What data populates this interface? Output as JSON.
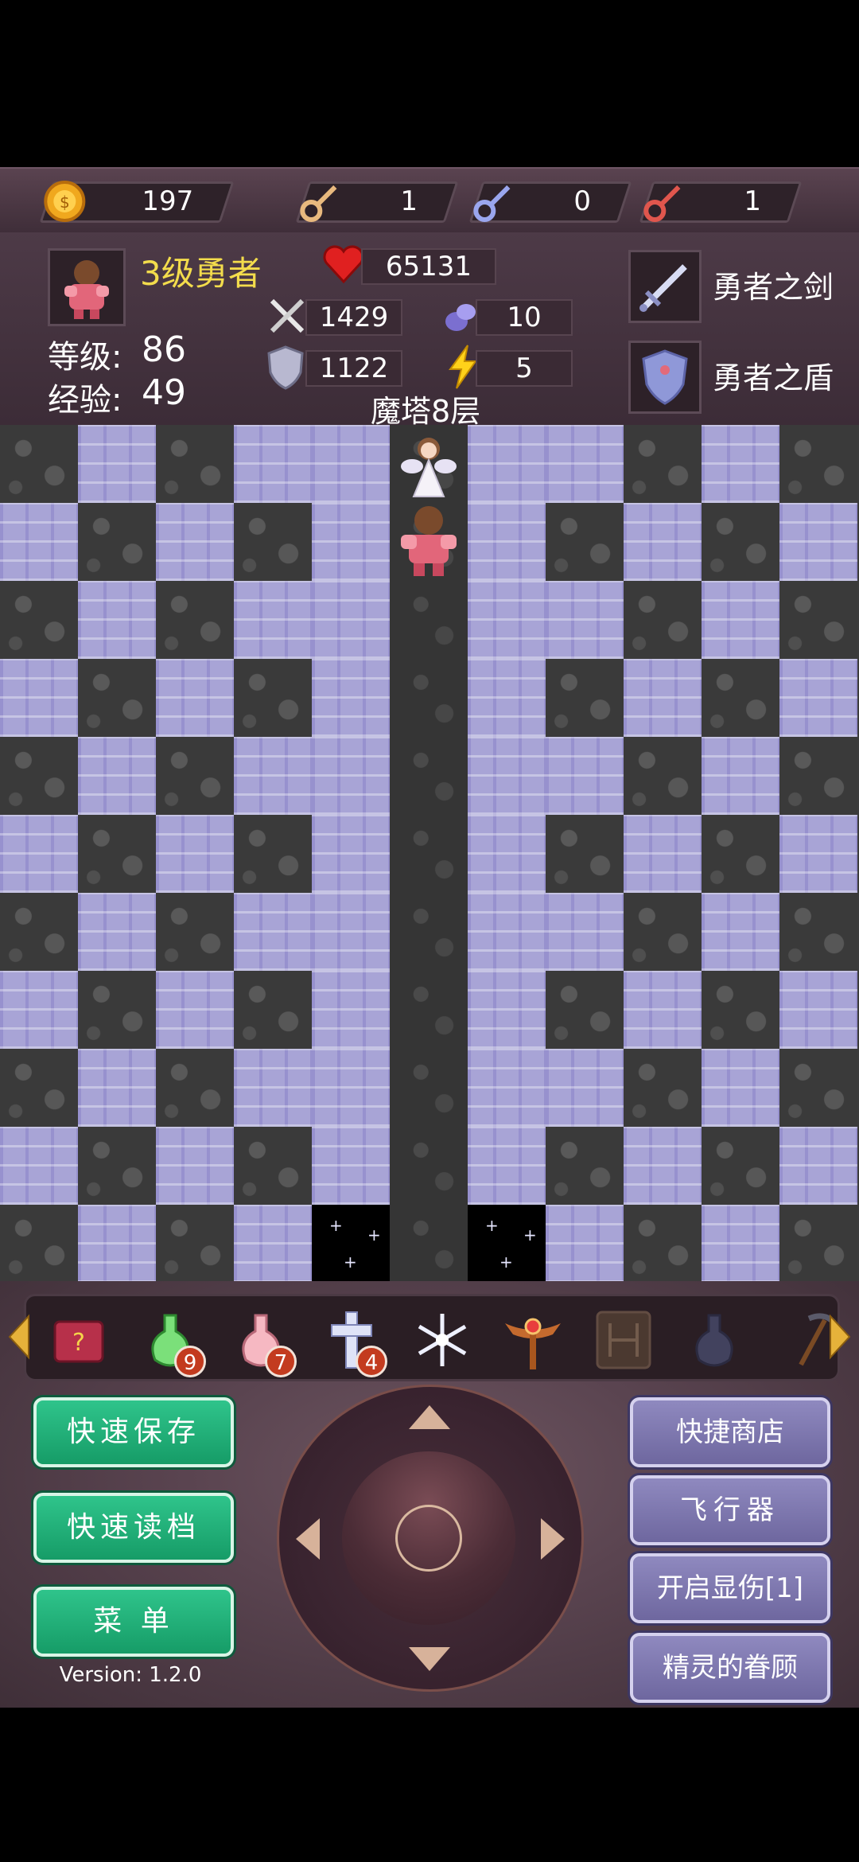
{
  "resources": {
    "gold": "197",
    "yellow_key": "1",
    "blue_key": "0",
    "red_key": "1"
  },
  "hero": {
    "title": "3级勇者",
    "level_label": "等级:",
    "level": "86",
    "exp_label": "经验:",
    "exp": "49",
    "hp": "65131",
    "atk": "1429",
    "def": "1122",
    "mdef": "10",
    "speed": "5",
    "floor": "魔塔8层"
  },
  "equipment": {
    "weapon": "勇者之剑",
    "shield": "勇者之盾"
  },
  "items": [
    {
      "icon": "book-icon",
      "count": ""
    },
    {
      "icon": "green-potion-icon",
      "count": "9"
    },
    {
      "icon": "pink-potion-icon",
      "count": "7"
    },
    {
      "icon": "cross-icon",
      "count": "4"
    },
    {
      "icon": "snowflake-icon",
      "count": ""
    },
    {
      "icon": "winged-staff-icon",
      "count": ""
    },
    {
      "icon": "rune-tablet-icon",
      "count": ""
    },
    {
      "icon": "dark-flask-icon",
      "count": ""
    },
    {
      "icon": "pickaxe-icon",
      "count": ""
    }
  ],
  "buttons": {
    "quick_save": "快速保存",
    "quick_load": "快速读档",
    "menu": "菜  单",
    "shop": "快捷商店",
    "fly": "飞行器",
    "damage": "开启显伤[1]",
    "fairy": "精灵的眷顾"
  },
  "version": "Version: 1.2.0",
  "colors": {
    "green_button": "#1fae75",
    "purple_button": "#7d77ae",
    "title_yellow": "#f3dc4c",
    "floor_tile": "#a8a4d6",
    "wall_tile": "#3a3a3a"
  }
}
